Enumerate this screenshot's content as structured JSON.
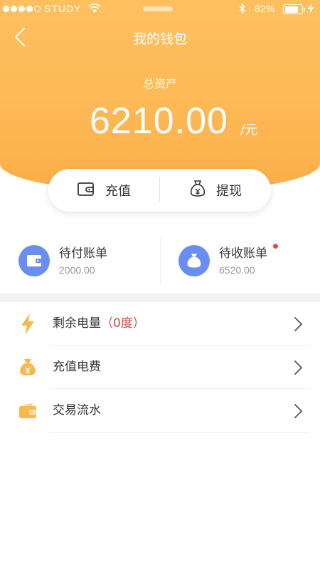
{
  "status_bar": {
    "carrier": "STUDY",
    "battery": "82%",
    "signal_bars_filled": 4,
    "signal_bars_total": 5,
    "battery_level": 0.82
  },
  "nav": {
    "title": "我的钱包",
    "back_icon": "chevron-left-icon"
  },
  "wallet": {
    "asset_label": "总资产",
    "amount": "6210.00",
    "unit": "/元"
  },
  "actions": {
    "recharge": {
      "label": "充值",
      "icon": "wallet-icon"
    },
    "withdraw": {
      "label": "提现",
      "icon": "money-bag-icon"
    }
  },
  "bills": {
    "pending_pay": {
      "title": "待付账单",
      "value": "2000.00",
      "icon": "wallet-icon"
    },
    "pending_receive": {
      "title": "待收账单",
      "value": "6520.00",
      "icon": "money-bag-icon",
      "has_notice": true
    }
  },
  "menu": {
    "items": [
      {
        "label": "剩余电量",
        "highlight": "（0度）",
        "icon": "lightning-icon"
      },
      {
        "label": "充值电费",
        "highlight": "",
        "icon": "money-bag-icon"
      },
      {
        "label": "交易流水",
        "highlight": "",
        "icon": "wallet-icon"
      }
    ]
  },
  "colors": {
    "header_gradient_top": "#fec05f",
    "header_gradient_bottom": "#fcae47",
    "bill_icon_bg": "#6a8df0",
    "menu_icon_accent": "#f8b84a",
    "highlight_red": "#d9453e",
    "notice_dot": "#e84a45"
  }
}
